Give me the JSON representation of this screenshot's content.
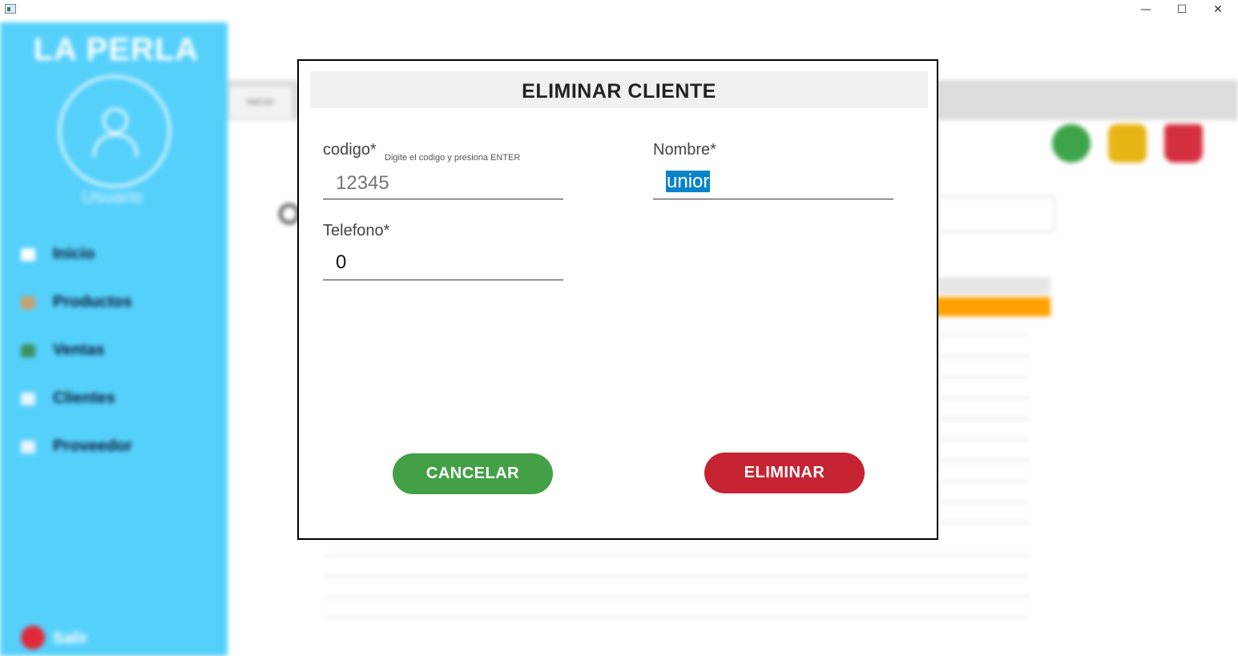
{
  "window": {
    "controls": {
      "minimize": "—",
      "maximize": "☐",
      "close": "✕"
    }
  },
  "sidebar": {
    "brand": "LA PERLA",
    "user_label": "Usuario",
    "items": [
      {
        "label": "Inicio",
        "icon": "home-icon",
        "color": "#ffffff"
      },
      {
        "label": "Productos",
        "icon": "products-icon",
        "color": "#c9a06a"
      },
      {
        "label": "Ventas",
        "icon": "sales-icon",
        "color": "#3e8f5a"
      },
      {
        "label": "Clientes",
        "icon": "clients-icon",
        "color": "#e8f4ff"
      },
      {
        "label": "Proveedor",
        "icon": "supplier-icon",
        "color": "#e8f4ff"
      }
    ],
    "exit_label": "Salir"
  },
  "background": {
    "tab_label": "INICIO",
    "action_icons": [
      "add-icon",
      "edit-icon",
      "trash-icon"
    ],
    "colors": {
      "add": "#3ea44a",
      "edit": "#e8b414",
      "delete": "#d4303e",
      "selected_row": "#ffa000",
      "sidebar": "#55d0fb"
    }
  },
  "modal": {
    "title": "ELIMINAR CLIENTE",
    "codigo": {
      "label": "codigo*",
      "hint": "Digite el codigo y presiona ENTER",
      "placeholder": "12345"
    },
    "nombre": {
      "label": "Nombre*",
      "value": "unior"
    },
    "telefono": {
      "label": "Telefono*",
      "value": "0"
    },
    "cancel_label": "CANCELAR",
    "delete_label": "ELIMINAR",
    "colors": {
      "cancel": "#43a047",
      "delete": "#c62333",
      "selection": "#0a84c6"
    }
  }
}
